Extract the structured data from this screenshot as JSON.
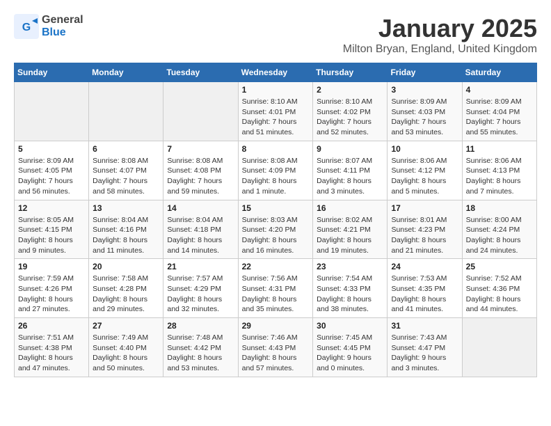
{
  "header": {
    "logo": {
      "general": "General",
      "blue": "Blue"
    },
    "title": "January 2025",
    "location": "Milton Bryan, England, United Kingdom"
  },
  "weekdays": [
    "Sunday",
    "Monday",
    "Tuesday",
    "Wednesday",
    "Thursday",
    "Friday",
    "Saturday"
  ],
  "weeks": [
    [
      {
        "day": "",
        "info": ""
      },
      {
        "day": "",
        "info": ""
      },
      {
        "day": "",
        "info": ""
      },
      {
        "day": "1",
        "info": "Sunrise: 8:10 AM\nSunset: 4:01 PM\nDaylight: 7 hours and 51 minutes."
      },
      {
        "day": "2",
        "info": "Sunrise: 8:10 AM\nSunset: 4:02 PM\nDaylight: 7 hours and 52 minutes."
      },
      {
        "day": "3",
        "info": "Sunrise: 8:09 AM\nSunset: 4:03 PM\nDaylight: 7 hours and 53 minutes."
      },
      {
        "day": "4",
        "info": "Sunrise: 8:09 AM\nSunset: 4:04 PM\nDaylight: 7 hours and 55 minutes."
      }
    ],
    [
      {
        "day": "5",
        "info": "Sunrise: 8:09 AM\nSunset: 4:05 PM\nDaylight: 7 hours and 56 minutes."
      },
      {
        "day": "6",
        "info": "Sunrise: 8:08 AM\nSunset: 4:07 PM\nDaylight: 7 hours and 58 minutes."
      },
      {
        "day": "7",
        "info": "Sunrise: 8:08 AM\nSunset: 4:08 PM\nDaylight: 7 hours and 59 minutes."
      },
      {
        "day": "8",
        "info": "Sunrise: 8:08 AM\nSunset: 4:09 PM\nDaylight: 8 hours and 1 minute."
      },
      {
        "day": "9",
        "info": "Sunrise: 8:07 AM\nSunset: 4:11 PM\nDaylight: 8 hours and 3 minutes."
      },
      {
        "day": "10",
        "info": "Sunrise: 8:06 AM\nSunset: 4:12 PM\nDaylight: 8 hours and 5 minutes."
      },
      {
        "day": "11",
        "info": "Sunrise: 8:06 AM\nSunset: 4:13 PM\nDaylight: 8 hours and 7 minutes."
      }
    ],
    [
      {
        "day": "12",
        "info": "Sunrise: 8:05 AM\nSunset: 4:15 PM\nDaylight: 8 hours and 9 minutes."
      },
      {
        "day": "13",
        "info": "Sunrise: 8:04 AM\nSunset: 4:16 PM\nDaylight: 8 hours and 11 minutes."
      },
      {
        "day": "14",
        "info": "Sunrise: 8:04 AM\nSunset: 4:18 PM\nDaylight: 8 hours and 14 minutes."
      },
      {
        "day": "15",
        "info": "Sunrise: 8:03 AM\nSunset: 4:20 PM\nDaylight: 8 hours and 16 minutes."
      },
      {
        "day": "16",
        "info": "Sunrise: 8:02 AM\nSunset: 4:21 PM\nDaylight: 8 hours and 19 minutes."
      },
      {
        "day": "17",
        "info": "Sunrise: 8:01 AM\nSunset: 4:23 PM\nDaylight: 8 hours and 21 minutes."
      },
      {
        "day": "18",
        "info": "Sunrise: 8:00 AM\nSunset: 4:24 PM\nDaylight: 8 hours and 24 minutes."
      }
    ],
    [
      {
        "day": "19",
        "info": "Sunrise: 7:59 AM\nSunset: 4:26 PM\nDaylight: 8 hours and 27 minutes."
      },
      {
        "day": "20",
        "info": "Sunrise: 7:58 AM\nSunset: 4:28 PM\nDaylight: 8 hours and 29 minutes."
      },
      {
        "day": "21",
        "info": "Sunrise: 7:57 AM\nSunset: 4:29 PM\nDaylight: 8 hours and 32 minutes."
      },
      {
        "day": "22",
        "info": "Sunrise: 7:56 AM\nSunset: 4:31 PM\nDaylight: 8 hours and 35 minutes."
      },
      {
        "day": "23",
        "info": "Sunrise: 7:54 AM\nSunset: 4:33 PM\nDaylight: 8 hours and 38 minutes."
      },
      {
        "day": "24",
        "info": "Sunrise: 7:53 AM\nSunset: 4:35 PM\nDaylight: 8 hours and 41 minutes."
      },
      {
        "day": "25",
        "info": "Sunrise: 7:52 AM\nSunset: 4:36 PM\nDaylight: 8 hours and 44 minutes."
      }
    ],
    [
      {
        "day": "26",
        "info": "Sunrise: 7:51 AM\nSunset: 4:38 PM\nDaylight: 8 hours and 47 minutes."
      },
      {
        "day": "27",
        "info": "Sunrise: 7:49 AM\nSunset: 4:40 PM\nDaylight: 8 hours and 50 minutes."
      },
      {
        "day": "28",
        "info": "Sunrise: 7:48 AM\nSunset: 4:42 PM\nDaylight: 8 hours and 53 minutes."
      },
      {
        "day": "29",
        "info": "Sunrise: 7:46 AM\nSunset: 4:43 PM\nDaylight: 8 hours and 57 minutes."
      },
      {
        "day": "30",
        "info": "Sunrise: 7:45 AM\nSunset: 4:45 PM\nDaylight: 9 hours and 0 minutes."
      },
      {
        "day": "31",
        "info": "Sunrise: 7:43 AM\nSunset: 4:47 PM\nDaylight: 9 hours and 3 minutes."
      },
      {
        "day": "",
        "info": ""
      }
    ]
  ]
}
